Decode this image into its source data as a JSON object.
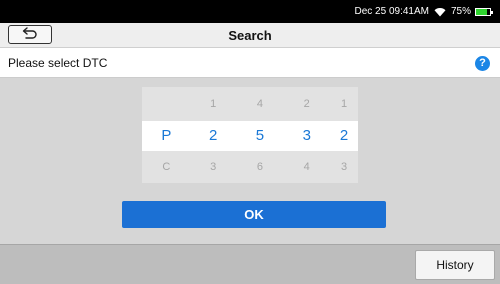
{
  "status_bar": {
    "datetime": "Dec 25 09:41AM",
    "battery_percent": "75%",
    "battery_level": 0.75,
    "wifi_icon": "wifi-icon",
    "battery_icon": "battery-icon"
  },
  "header": {
    "title": "Search",
    "back_icon": "back-arrow-icon"
  },
  "prompt": {
    "text": "Please select DTC",
    "help_label": "?"
  },
  "picker": {
    "above": [
      "",
      "1",
      "4",
      "2",
      "1"
    ],
    "selected": [
      "P",
      "2",
      "5",
      "3",
      "2"
    ],
    "below": [
      "C",
      "3",
      "6",
      "4",
      "3"
    ]
  },
  "actions": {
    "ok_label": "OK",
    "history_label": "History"
  },
  "colors": {
    "accent": "#1b70d4",
    "selected_text": "#1a78d6",
    "battery": "#2fd42f"
  }
}
